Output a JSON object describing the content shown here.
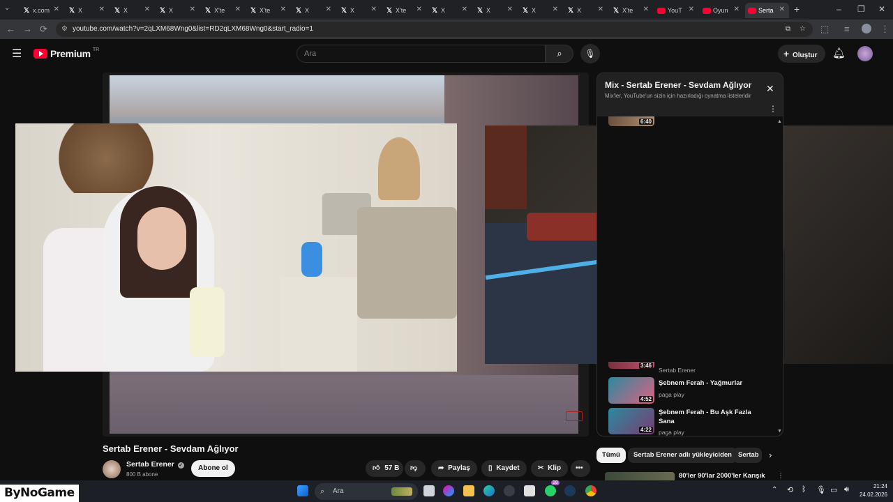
{
  "browser": {
    "tabs": [
      {
        "label": "x.com",
        "icon": "x-icon"
      },
      {
        "label": "X",
        "icon": "x-icon"
      },
      {
        "label": "X",
        "icon": "x-icon"
      },
      {
        "label": "X",
        "icon": "x-icon"
      },
      {
        "label": "X'te",
        "icon": "x-icon"
      },
      {
        "label": "X'te",
        "icon": "x-icon"
      },
      {
        "label": "X",
        "icon": "x-icon"
      },
      {
        "label": "X",
        "icon": "x-icon"
      },
      {
        "label": "X'te",
        "icon": "x-icon"
      },
      {
        "label": "X",
        "icon": "x-icon"
      },
      {
        "label": "X",
        "icon": "x-icon"
      },
      {
        "label": "X",
        "icon": "x-icon"
      },
      {
        "label": "X",
        "icon": "x-icon"
      },
      {
        "label": "X'te",
        "icon": "x-icon"
      },
      {
        "label": "YouT",
        "icon": "youtube-icon"
      },
      {
        "label": "Oyun",
        "icon": "youtube-icon"
      },
      {
        "label": "Serta",
        "icon": "youtube-icon"
      }
    ],
    "url": "youtube.com/watch?v=2qLXM68Wng0&list=RD2qLXM68Wng0&start_radio=1"
  },
  "youtube": {
    "logo_text": "Premium",
    "logo_region": "TR",
    "search_placeholder": "Ara",
    "create_label": "Oluştur"
  },
  "video": {
    "title": "Sertab Erener - Sevdam Ağlıyor",
    "channel": "Sertab Erener",
    "subscribers": "800 B abone",
    "subscribe_label": "Abone ol",
    "likes": "57 B",
    "share_label": "Paylaş",
    "save_label": "Kaydet",
    "clip_label": "Klip"
  },
  "playlist": {
    "title": "Mix - Sertab Erener - Sevdam Ağlıyor",
    "subtitle": "Mix'ler, YouTube'un sizin için hazırladığı oynatma listeleridir",
    "items": [
      {
        "duration": "6:40",
        "title": "",
        "channel": ""
      },
      {
        "duration": "3:46",
        "title": "",
        "channel": "Sertab Erener"
      },
      {
        "duration": "4:52",
        "title": "Şebnem Ferah - Yağmurlar",
        "channel": "paga play"
      },
      {
        "duration": "4:22",
        "title": "Şebnem Ferah - Bu Aşk Fazla Sana",
        "channel": "paga play"
      }
    ]
  },
  "chips": [
    "Tümü",
    "Sertab Erener adlı yükleyiciden",
    "Sertab"
  ],
  "recommended": {
    "title": "80'ler 90'lar 2000'ler Karışık"
  },
  "taskbar": {
    "search_placeholder": "Ara",
    "time": "21:24",
    "date": "24.02.2026",
    "whatsapp_badge": "18"
  },
  "watermark": "ByNoGame",
  "colors": {
    "accent": "#ff0033",
    "bg": "#0f0f0f"
  }
}
